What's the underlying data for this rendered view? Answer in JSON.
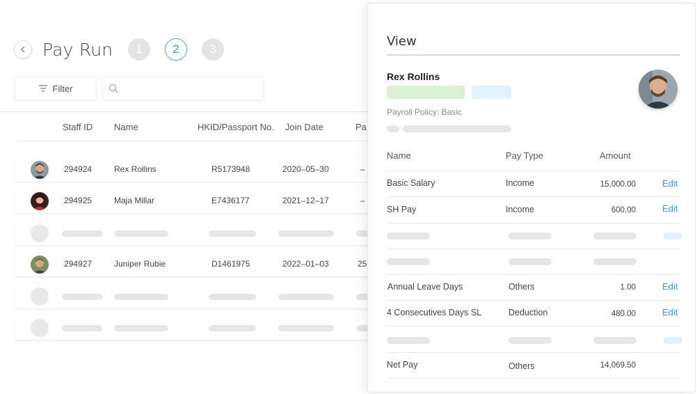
{
  "header": {
    "title": "Pay Run",
    "steps": [
      "1",
      "2",
      "3"
    ],
    "active_step": "2"
  },
  "toolbar": {
    "filter_label": "Filter",
    "search_placeholder": ""
  },
  "table": {
    "columns": [
      "Staff ID",
      "Name",
      "HKID/Passport No.",
      "Join Date",
      "Pa"
    ],
    "rows": [
      {
        "staff_id": "294924",
        "name": "Rex Rollins",
        "hkid": "R5173948",
        "join_date": "2020–05–30",
        "pay": "–"
      },
      {
        "staff_id": "294925",
        "name": "Maja Millar",
        "hkid": "E7436177",
        "join_date": "2021–12–17",
        "pay": "–"
      },
      {
        "staff_id": "294927",
        "name": "Juniper Rubie",
        "hkid": "D1461975",
        "join_date": "2022–01–03",
        "pay": "25"
      }
    ]
  },
  "panel": {
    "title": "View",
    "employee_name": "Rex Rollins",
    "policy": "Payroll Policy: Basic",
    "columns": {
      "name": "Name",
      "pay_type": "Pay Type",
      "amount": "Amount"
    },
    "edit_label": "Edit",
    "items": [
      {
        "name": "Basic Salary",
        "type": "Income",
        "amount": "15,000.00"
      },
      {
        "name": "SH Pay",
        "type": "Income",
        "amount": "600,00"
      },
      {
        "name": "Annual Leave Days",
        "type": "Others",
        "amount": "1.00"
      },
      {
        "name": "4 Consecutives Days SL",
        "type": "Deduction",
        "amount": "480.00"
      },
      {
        "name": "Net Pay",
        "type": "Others",
        "amount": "14,069.50"
      }
    ]
  },
  "colors": {
    "accent": "#3d96d6",
    "step_inactive": "#e4e4e4",
    "tag_green": "#dcf0d6",
    "tag_blue": "#e3f1fc",
    "skeleton": "#e6e6e6"
  },
  "icons": {
    "back": "chevron-left-icon",
    "filter": "filter-lines-icon",
    "search": "search-icon"
  }
}
